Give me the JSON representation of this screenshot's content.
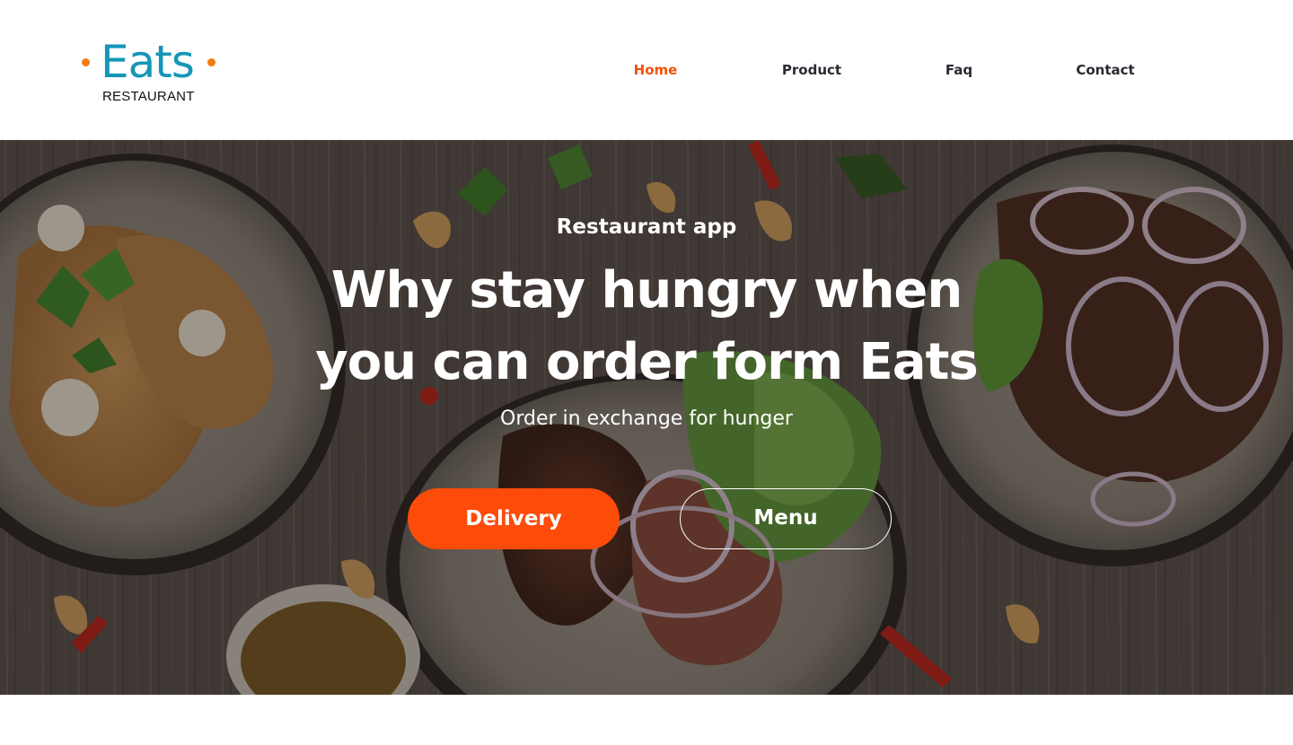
{
  "brand": {
    "name": "Eats",
    "tagline": "RESTAURANT",
    "colors": {
      "wordmark": "#1596b8",
      "dots": "#f07d10"
    }
  },
  "nav": {
    "items": [
      {
        "label": "Home",
        "active": true
      },
      {
        "label": "Product",
        "active": false
      },
      {
        "label": "Faq",
        "active": false
      },
      {
        "label": "Contact",
        "active": false
      }
    ],
    "active_color": "#f4510b"
  },
  "hero": {
    "kicker": "Restaurant app",
    "title_line1": "Why stay hungry when",
    "title_line2": "you can order form Eats",
    "subtitle": "Order in exchange for hunger",
    "primary_button": "Delivery",
    "secondary_button": "Menu",
    "background_image": "food-plates-photo",
    "accent_color": "#fd4b0a"
  }
}
